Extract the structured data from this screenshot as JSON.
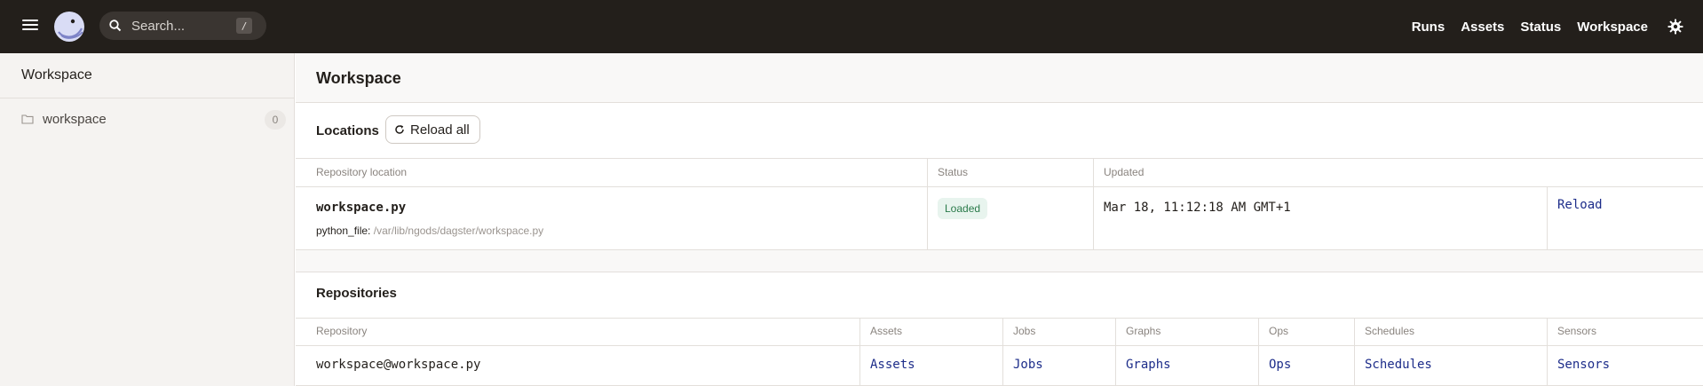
{
  "topbar": {
    "search_placeholder": "Search...",
    "search_shortcut": "/",
    "nav": [
      "Runs",
      "Assets",
      "Status",
      "Workspace"
    ]
  },
  "sidebar": {
    "title": "Workspace",
    "items": [
      {
        "label": "workspace",
        "count": "0"
      }
    ]
  },
  "main": {
    "title": "Workspace",
    "locations": {
      "heading": "Locations",
      "reload_all_label": "Reload all",
      "columns": [
        "Repository location",
        "Status",
        "Updated"
      ],
      "rows": [
        {
          "name": "workspace.py",
          "meta_label": "python_file:",
          "meta_path": "/var/lib/ngods/dagster/workspace.py",
          "status": "Loaded",
          "updated": "Mar 18, 11:12:18 AM GMT+1",
          "action": "Reload"
        }
      ]
    },
    "repositories": {
      "heading": "Repositories",
      "columns": [
        "Repository",
        "Assets",
        "Jobs",
        "Graphs",
        "Ops",
        "Schedules",
        "Sensors"
      ],
      "rows": [
        {
          "name": "workspace@workspace.py",
          "links": [
            "Assets",
            "Jobs",
            "Graphs",
            "Ops",
            "Schedules",
            "Sensors"
          ]
        }
      ]
    }
  },
  "colors": {
    "topbar": "#231f1b",
    "link": "#1d2d8a",
    "status_loaded_bg": "#e8f4ee",
    "status_loaded_text": "#2a7a4a"
  },
  "icons": [
    "menu-icon",
    "dagster-logo",
    "search-icon",
    "gear-icon",
    "folder-icon",
    "refresh-icon"
  ]
}
